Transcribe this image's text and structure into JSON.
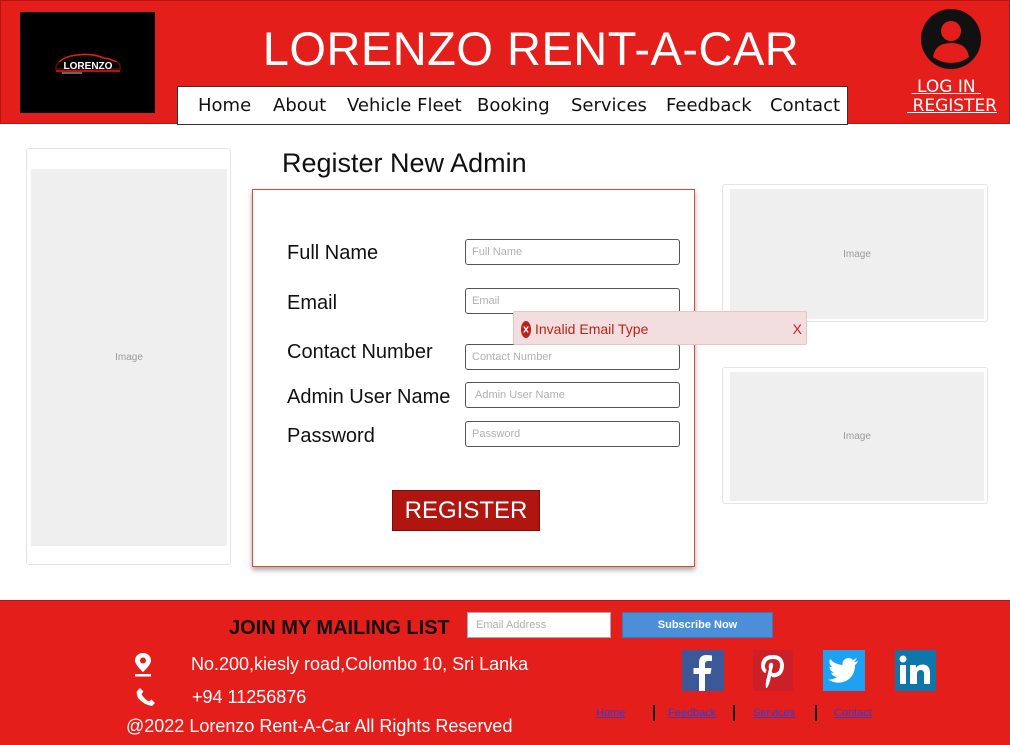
{
  "header": {
    "site_title": "LORENZO RENT-A-CAR",
    "logo_text": "LORENZO",
    "nav": [
      "Home",
      "About",
      "Vehicle Fleet",
      "Booking",
      "Services",
      "Feedback",
      "Contact"
    ],
    "login_label": " LOG IN ",
    "register_label": " REGISTER"
  },
  "placeholders": {
    "image_label": "Image"
  },
  "form": {
    "title": "Register New Admin",
    "fields": [
      {
        "label": "Full Name",
        "placeholder": "Full Name"
      },
      {
        "label": "Email",
        "placeholder": "Email"
      },
      {
        "label": "Contact Number",
        "placeholder": "Contact Number"
      },
      {
        "label": "Admin User Name",
        "placeholder": "Admin User Name"
      },
      {
        "label": "Password",
        "placeholder": "Password"
      }
    ],
    "submit_label": "REGISTER",
    "error": {
      "message": "Invalid Email Type",
      "close": "X"
    }
  },
  "footer": {
    "mailing_label": "JOIN MY MAILING LIST",
    "email_placeholder": "Email Address",
    "subscribe_label": "Subscribe Now",
    "address": "No.200,kiesly road,Colombo 10, Sri Lanka",
    "phone": "+94 11256876",
    "copyright": "@2022 Lorenzo Rent-A-Car All Rights Reserved",
    "links": [
      "Home",
      "Feedback",
      "Services",
      "Contact"
    ],
    "social": [
      "facebook-icon",
      "pinterest-icon",
      "twitter-icon",
      "linkedin-icon"
    ]
  },
  "colors": {
    "brand_red": "#e41e1a",
    "button_red": "#b0150f",
    "subscribe_blue": "#4a8fd8",
    "error_bg": "#f2dede"
  }
}
